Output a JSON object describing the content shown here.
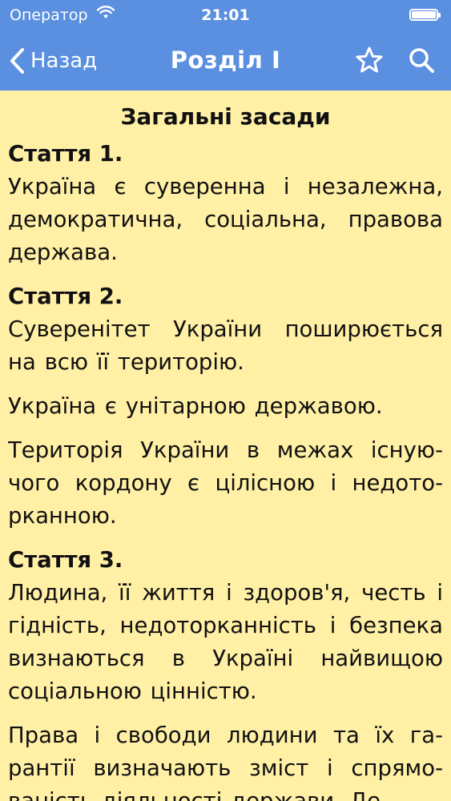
{
  "status": {
    "carrier": "Оператор",
    "time": "21:01"
  },
  "nav": {
    "back_label": "Назад",
    "title": "Розділ I"
  },
  "content": {
    "section_title": "Загальні засади",
    "articles": [
      {
        "title": "Стаття 1.",
        "paragraphs": [
          "Україна є суверенна і незалежна, демократична, соціальна, правова держава."
        ]
      },
      {
        "title": "Стаття 2.",
        "paragraphs": [
          "Суверенітет України поширюється на всю її територію.",
          "Україна є унітарною державою.",
          "Територія України в межах існую­чого кордону є цілісною і недото­рканною."
        ]
      },
      {
        "title": "Стаття 3.",
        "paragraphs": [
          "Людина, її життя і здоров'я, честь і гідність, недоторканність і без­пека визнаються в Україні найви­щою соціальною цінністю.",
          "Права і свободи людини та їх га­рантії визначають зміст і спрямо­ваність діяльності держави. Де-"
        ]
      }
    ]
  },
  "colors": {
    "nav_background": "#5b8fe0",
    "page_background": "#fff0a6"
  }
}
